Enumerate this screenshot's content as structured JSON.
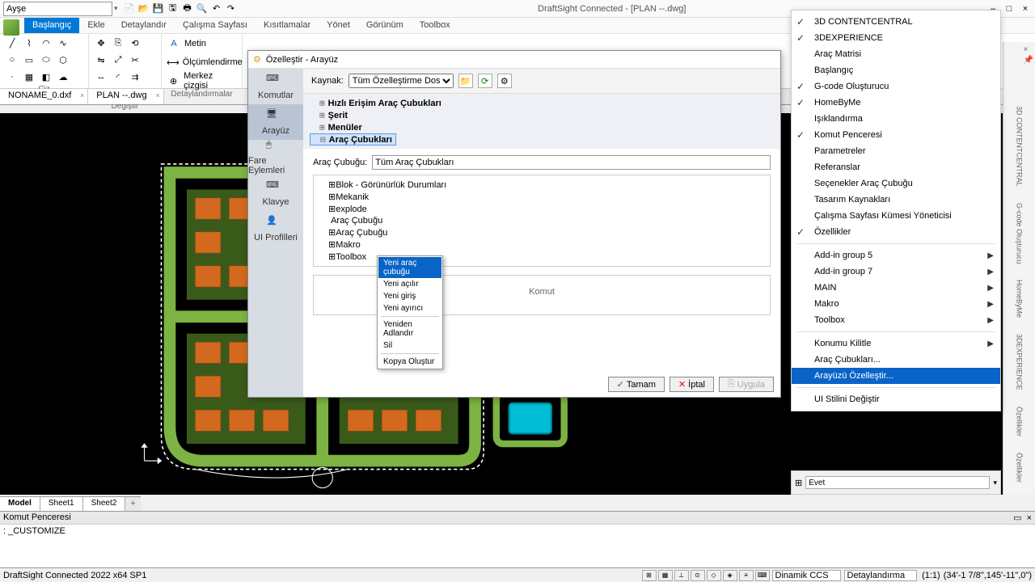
{
  "titlebar": {
    "layer_value": "Ayşe",
    "app_title": "DraftSight Connected - [PLAN --.dwg]",
    "win_min": "–",
    "win_max": "□",
    "win_close": "×"
  },
  "ribbon": {
    "tabs": [
      "Başlangıç",
      "Ekle",
      "Detaylandır",
      "Çalışma Sayfası",
      "Kısıtlamalar",
      "Yönet",
      "Görünüm",
      "Toolbox"
    ],
    "active_tab": 0,
    "panels": {
      "ciz": "Çiz",
      "degistir": "Değiştir",
      "detay": "Detaylandırmalar",
      "metin": "Metin",
      "olcum": "Ölçümlendirme",
      "merkez": "Merkez çizgisi"
    }
  },
  "doc_tabs": [
    {
      "label": "NONAME_0.dxf",
      "active": false
    },
    {
      "label": "PLAN --.dwg",
      "active": true
    }
  ],
  "sheet_tabs": [
    "Model",
    "Sheet1",
    "Sheet2"
  ],
  "cmd_window": {
    "title": "Komut Penceresi",
    "line": ": _CUSTOMIZE"
  },
  "statusbar": {
    "left": "DraftSight Connected 2022  x64 SP1",
    "dinamik": "Dinamik CCS",
    "detay": "Detaylandırma",
    "scale": "(1:1)",
    "coords": "(34'-1 7/8\",145'-11\",0\")"
  },
  "dialog": {
    "title": "Özelleştir - Arayüz",
    "sidebar": [
      "Komutlar",
      "Arayüz",
      "Fare Eylemleri",
      "Klavye",
      "UI Profilleri"
    ],
    "sidebar_active": 1,
    "src_label": "Kaynak:",
    "src_value": "Tüm Özelleştirme Dosyaları",
    "tree": [
      "Hızlı Erişim Araç Çubukları",
      "Şerit",
      "Menüler",
      "Araç Çubukları"
    ],
    "tree_active": 3,
    "tb_label": "Araç Çubuğu:",
    "tb_value": "Tüm Araç Çubukları",
    "subtree": [
      "Blok - Görünürlük Durumları",
      "Mekanik",
      "explode",
      "Araç Çubuğu",
      "Araç Çubuğu",
      "Makro",
      "Toolbox"
    ],
    "cmd_label": "Komut",
    "ok": "Tamam",
    "cancel": "İptal",
    "apply": "Uygula"
  },
  "ctx_menu": {
    "items": [
      "Yeni araç çubuğu",
      "Yeni açılır",
      "Yeni giriş",
      "Yeni ayırıcı"
    ],
    "items2": [
      "Yeniden Adlandır",
      "Sil"
    ],
    "items3": [
      "Kopya Oluştur"
    ],
    "hl": 0
  },
  "right_menu": {
    "items_checked": [
      {
        "label": "3D CONTENTCENTRAL",
        "chk": true
      },
      {
        "label": "3DEXPERIENCE",
        "chk": true
      },
      {
        "label": "Araç Matrisi",
        "chk": false
      },
      {
        "label": "Başlangıç",
        "chk": false
      },
      {
        "label": "G-code Oluşturucu",
        "chk": true
      },
      {
        "label": "HomeByMe",
        "chk": true
      },
      {
        "label": "Işıklandırma",
        "chk": false
      },
      {
        "label": "Komut Penceresi",
        "chk": true
      },
      {
        "label": "Parametreler",
        "chk": false
      },
      {
        "label": "Referanslar",
        "chk": false
      },
      {
        "label": "Seçenekler Araç Çubuğu",
        "chk": false
      },
      {
        "label": "Tasarım Kaynakları",
        "chk": false
      },
      {
        "label": "Çalışma Sayfası Kümesi Yöneticisi",
        "chk": false
      },
      {
        "label": "Özellikler",
        "chk": true
      }
    ],
    "subs": [
      {
        "label": "Add-in group 5",
        "arr": true
      },
      {
        "label": "Add-in group 7",
        "arr": true
      },
      {
        "label": "MAIN",
        "arr": true
      },
      {
        "label": "Makro",
        "arr": true
      },
      {
        "label": "Toolbox",
        "arr": true
      }
    ],
    "bottom": [
      {
        "label": "Konumu Kilitle",
        "arr": true
      },
      {
        "label": "Araç Çubukları...",
        "arr": false
      },
      {
        "label": "Arayüzü Özelleştir...",
        "arr": false,
        "hl": true
      }
    ],
    "last": {
      "label": "UI Stilini Değiştir"
    }
  },
  "prop_input": "Evet",
  "right_tabs": [
    "3D CONTENTCENTRAL",
    "G-code Oluşturucu",
    "HomeByMe",
    "3DEXPERIENCE",
    "Özellikler",
    "Özellikler"
  ]
}
